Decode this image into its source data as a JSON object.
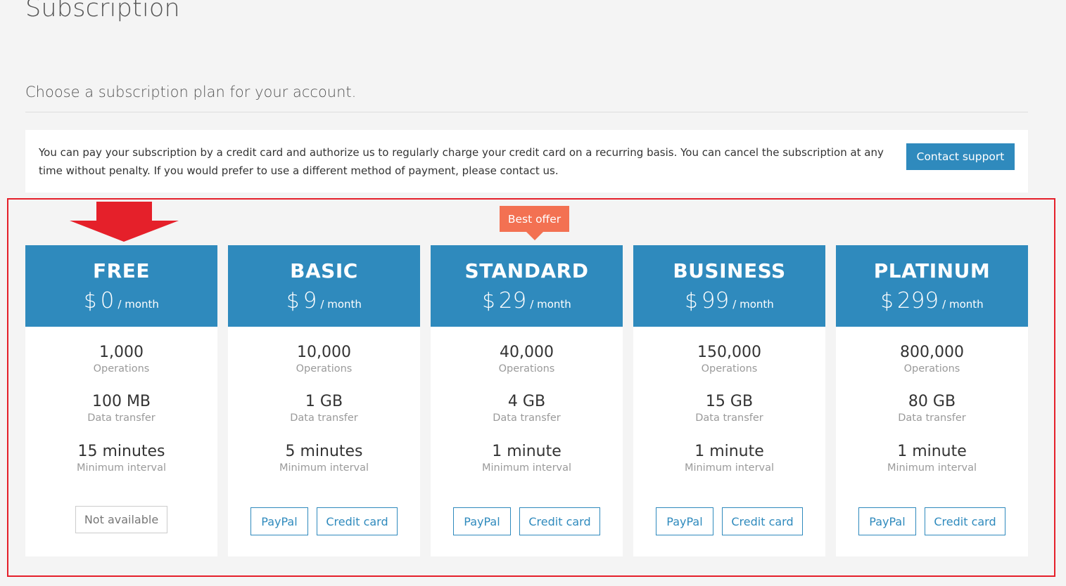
{
  "page": {
    "title": "Subscription",
    "subtitle": "Choose a subscription plan for your account."
  },
  "info": {
    "text": "You can pay your subscription by a credit card and authorize us to regularly charge your credit card on a recurring basis. You can cancel the subscription at any time without penalty. If you would prefer to use a different method of payment, please contact us.",
    "contact_label": "Contact support"
  },
  "badge": {
    "label": "Best offer"
  },
  "labels": {
    "currency": "$",
    "per_month": "/ month",
    "operations": "Operations",
    "data_transfer": "Data transfer",
    "minimum_interval": "Minimum interval",
    "paypal": "PayPal",
    "credit_card": "Credit card",
    "not_available": "Not available"
  },
  "plans": [
    {
      "name": "FREE",
      "price": "0",
      "operations": "1,000",
      "data_transfer": "100 MB",
      "interval": "15 minutes",
      "available": false
    },
    {
      "name": "BASIC",
      "price": "9",
      "operations": "10,000",
      "data_transfer": "1 GB",
      "interval": "5 minutes",
      "available": true
    },
    {
      "name": "STANDARD",
      "price": "29",
      "operations": "40,000",
      "data_transfer": "4 GB",
      "interval": "1 minute",
      "available": true,
      "highlighted": true
    },
    {
      "name": "BUSINESS",
      "price": "99",
      "operations": "150,000",
      "data_transfer": "15 GB",
      "interval": "1 minute",
      "available": true
    },
    {
      "name": "PLATINUM",
      "price": "299",
      "operations": "800,000",
      "data_transfer": "80 GB",
      "interval": "1 minute",
      "available": true
    }
  ],
  "colors": {
    "primary": "#2f8abd",
    "badge": "#f37152",
    "annotation": "#e5202a",
    "background": "#f4f4f4"
  }
}
